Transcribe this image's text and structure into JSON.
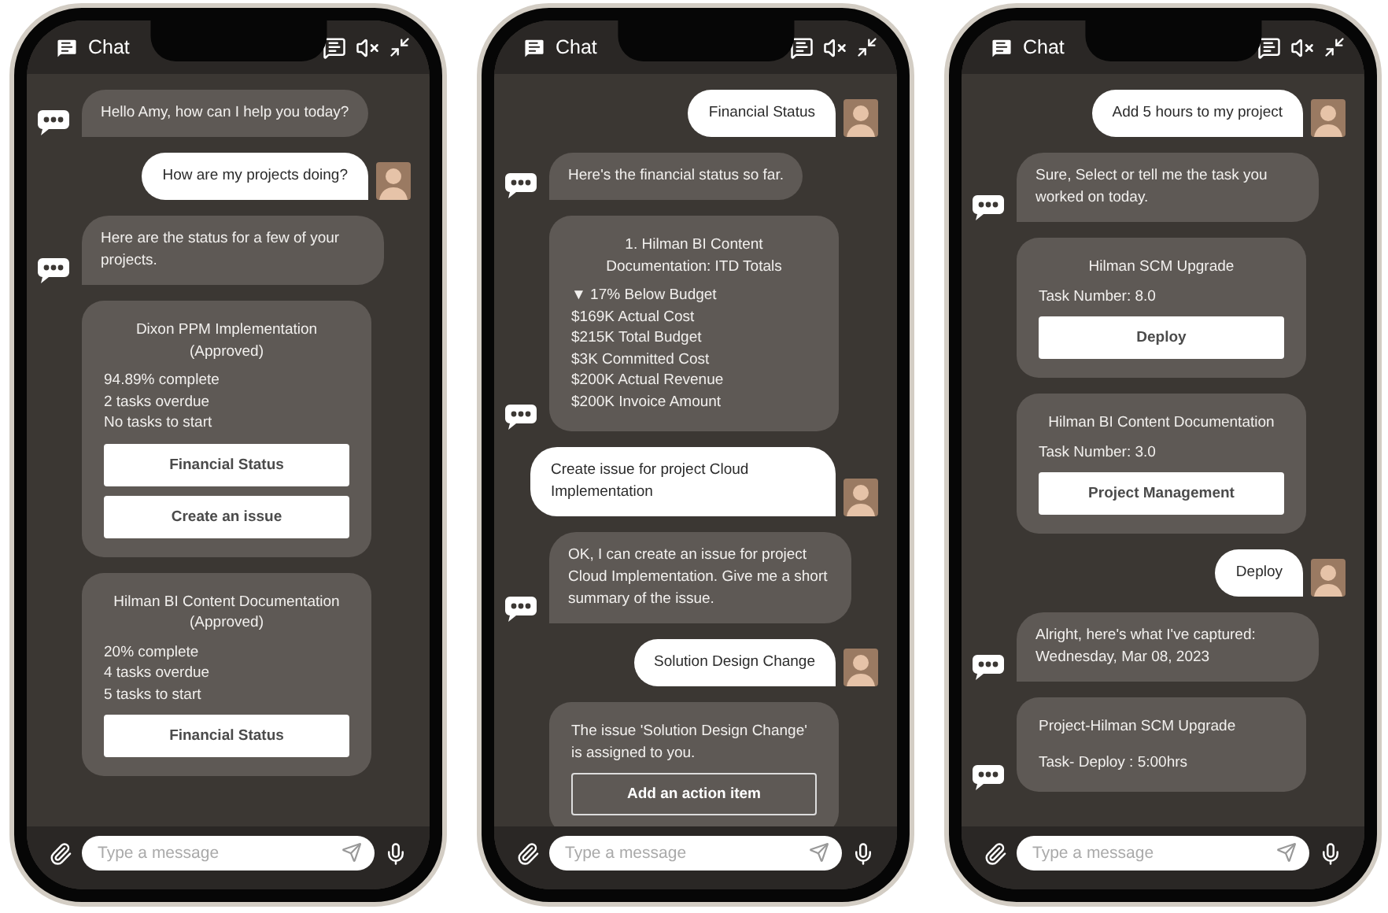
{
  "phones": [
    {
      "header": {
        "title": "Chat"
      },
      "messages": [
        {
          "kind": "bot",
          "text": "Hello Amy, how can I help you today?",
          "bot_icon": true
        },
        {
          "kind": "user",
          "text": "How are my projects doing?"
        },
        {
          "kind": "bot",
          "text": "Here are the status for a few of your projects.",
          "bot_icon": true
        },
        {
          "kind": "card",
          "title": "Dixon PPM Implementation (Approved)",
          "lines": [
            "94.89% complete",
            "2 tasks overdue",
            "No tasks to start"
          ],
          "buttons": [
            {
              "label": "Financial Status"
            },
            {
              "label": "Create an issue"
            }
          ],
          "bot_icon": false
        },
        {
          "kind": "card",
          "title": "Hilman BI Content Documentation (Approved)",
          "lines": [
            "20% complete",
            "4 tasks overdue",
            "5 tasks to start"
          ],
          "buttons": [
            {
              "label": "Financial Status"
            }
          ],
          "bot_icon": false
        }
      ],
      "composer": {
        "placeholder": "Type a message"
      }
    },
    {
      "header": {
        "title": "Chat"
      },
      "messages": [
        {
          "kind": "user",
          "text": "Financial Status"
        },
        {
          "kind": "bot",
          "text": "Here's the financial status so far.",
          "bot_icon": true
        },
        {
          "kind": "card",
          "title": "1. Hilman BI Content Documentation: ITD Totals",
          "lines": [
            "▼ 17% Below Budget",
            "$169K Actual Cost",
            "$215K Total Budget",
            "$3K Committed Cost",
            "$200K Actual Revenue",
            "$200K Invoice Amount"
          ],
          "bot_icon": true
        },
        {
          "kind": "user",
          "text": "Create issue for project Cloud Implementation"
        },
        {
          "kind": "bot",
          "text": "OK, I can create an issue for project Cloud Implementation. Give me a short summary of the issue.",
          "bot_icon": true
        },
        {
          "kind": "user",
          "text": "Solution Design Change"
        },
        {
          "kind": "notice_card",
          "text": "The issue 'Solution Design Change' is assigned to you.",
          "buttons": [
            {
              "label": "Add an action item"
            }
          ],
          "bot_icon": false
        }
      ],
      "composer": {
        "placeholder": "Type a message"
      }
    },
    {
      "header": {
        "title": "Chat"
      },
      "messages": [
        {
          "kind": "user",
          "text": "Add 5 hours to my project"
        },
        {
          "kind": "bot",
          "text": "Sure, Select or tell me the task you worked on today.",
          "bot_icon": true
        },
        {
          "kind": "card",
          "title": "Hilman SCM Upgrade",
          "lines": [
            "Task Number: 8.0"
          ],
          "buttons": [
            {
              "label": "Deploy"
            }
          ],
          "bot_icon": false
        },
        {
          "kind": "card",
          "title": "Hilman BI Content Documentation",
          "lines": [
            "Task Number: 3.0"
          ],
          "buttons": [
            {
              "label": "Project Management"
            }
          ],
          "bot_icon": false
        },
        {
          "kind": "user",
          "text": "Deploy"
        },
        {
          "kind": "bot",
          "text": "Alright, here's what I've captured: Wednesday, Mar 08, 2023",
          "bot_icon": true
        },
        {
          "kind": "summary_card",
          "lines": [
            "Project-Hilman SCM Upgrade",
            "Task- Deploy : 5:00hrs"
          ],
          "bot_icon": true
        }
      ],
      "composer": {
        "placeholder": "Type a message"
      }
    }
  ]
}
